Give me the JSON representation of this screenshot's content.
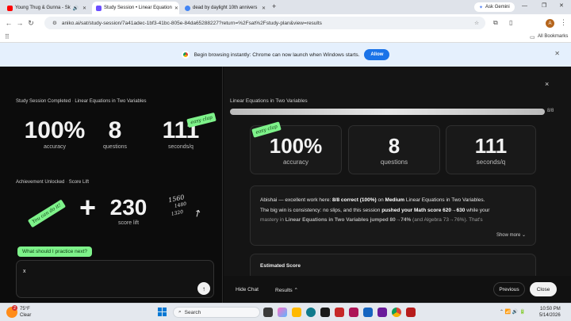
{
  "browser": {
    "tabs": [
      {
        "label": "Young Thug & Gunna - Sk",
        "fav_color": "#ff0000"
      },
      {
        "label": "Study Session • Linear Equation",
        "fav_color": "#6b4eff"
      },
      {
        "label": "dead by daylight 10th annivers",
        "fav_color": "#4285f4"
      }
    ],
    "new_tab": "+",
    "ask_gemini": "Ask Gemini",
    "url": "aniko.ai/sat/study-session/7a41adec-1bf3-41bc-805e-84da65288227?return=%2Fsat%2Fstudy-plan&view=results",
    "profile_initial": "A",
    "all_bookmarks": "All Bookmarks",
    "infobar_text": "Begin browsing instantly: Chrome can now launch when Windows starts.",
    "infobar_button": "Allow"
  },
  "left": {
    "crumb1_a": "Study Session Completed",
    "crumb1_b": "Linear Equations in Two Variables",
    "stats": [
      {
        "value": "100%",
        "label": "accuracy"
      },
      {
        "value": "8",
        "label": "questions"
      },
      {
        "value": "111",
        "label": "seconds/q"
      }
    ],
    "sticker_easy": "easy clap",
    "crumb2_a": "Achievement Unlocked",
    "crumb2_b": "Score Lift",
    "sticker_you": "You can do it!",
    "lift_value": "230",
    "lift_label": "score lift",
    "scribble": [
      "1560",
      "1480",
      "1320"
    ],
    "question_chip": "What should I practice next?",
    "input_value": "x",
    "send_icon": "↑"
  },
  "right": {
    "title": "Linear Equations in Two Variables",
    "progress_label": "8/8",
    "progress_fraction": 1.0,
    "sticker_easy": "easy clap",
    "stats": [
      {
        "value": "100%",
        "label": "accuracy"
      },
      {
        "value": "8",
        "label": "questions"
      },
      {
        "value": "111",
        "label": "seconds/q"
      }
    ],
    "summary_1": "Abishai — excellent work here: ",
    "summary_b1": "8/8 correct (100%)",
    "summary_2": " on ",
    "summary_b2": "Medium",
    "summary_3": " Linear Equations in Two Variables.",
    "summary_4": "The big win is consistency: no slips, and this session ",
    "summary_b3": "pushed your Math score 620→630",
    "summary_5": " while your",
    "summary_6": "mastery in ",
    "summary_b4": "Linear Equations in Two Variables jumped 80→74%",
    "summary_7": " (and Algebra 73→76%). That's",
    "show_more": "Show more",
    "estimated_score": "Estimated Score",
    "hide_chat": "Hide Chat",
    "results": "Results",
    "previous": "Previous",
    "close": "Close",
    "close_x": "×"
  },
  "taskbar": {
    "temp": "75°F",
    "weather": "Clear",
    "weather_badge": "2",
    "search": "Search",
    "time": "10:50 PM",
    "date": "5/14/2026"
  }
}
